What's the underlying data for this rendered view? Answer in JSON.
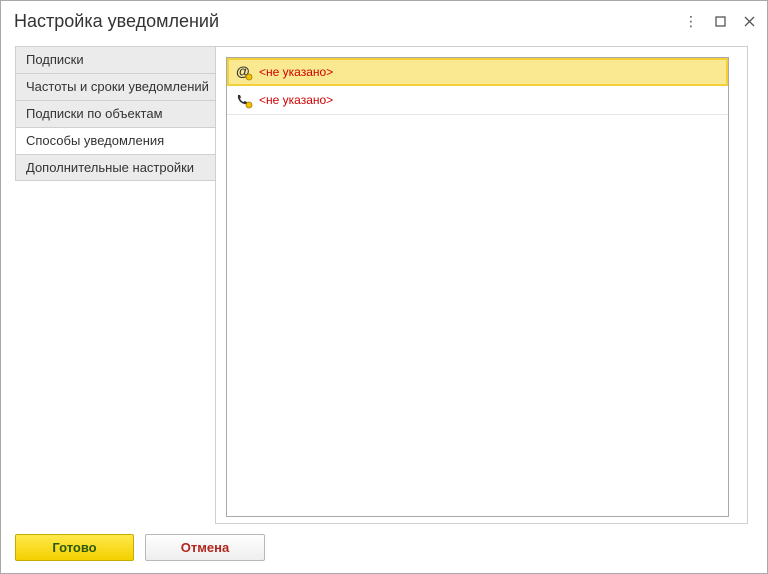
{
  "window": {
    "title": "Настройка уведомлений"
  },
  "controls": {
    "more": "⋮",
    "maximize": "☐",
    "close": "✕"
  },
  "tabs": [
    {
      "label": "Подписки"
    },
    {
      "label": "Частоты и сроки уведомлений"
    },
    {
      "label": "Подписки по объектам"
    },
    {
      "label": "Способы уведомления"
    },
    {
      "label": "Дополнительные настройки"
    }
  ],
  "active_tab": "Способы уведомления",
  "methods": [
    {
      "icon": "email-icon",
      "value": "<не указано>"
    },
    {
      "icon": "phone-icon",
      "value": "<не указано>"
    }
  ],
  "buttons": {
    "ok": "Готово",
    "cancel": "Отмена"
  },
  "colors": {
    "selection": "#fbe991",
    "placeholder_text": "#d10000",
    "ok_button": "#f4d000"
  }
}
